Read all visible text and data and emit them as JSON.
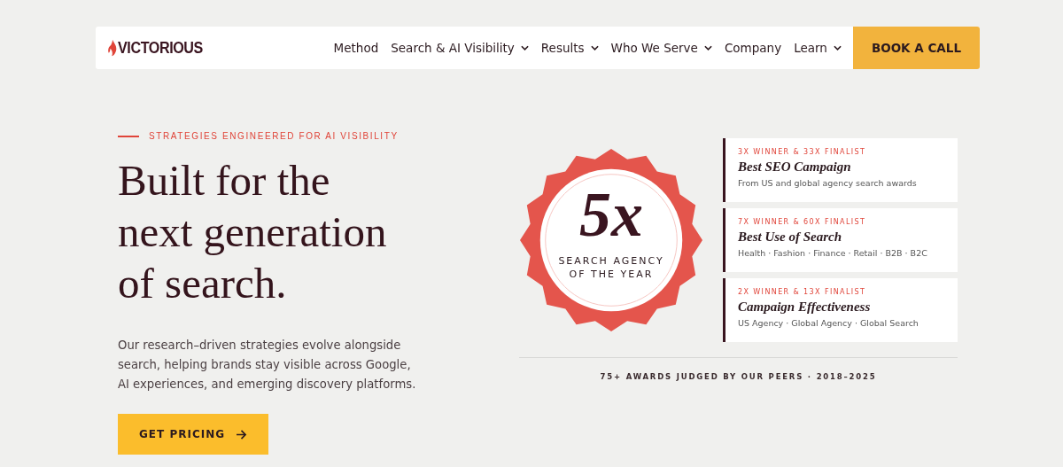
{
  "header": {
    "logo": "VICTORIOUS",
    "nav": [
      {
        "label": "Method",
        "has_menu": false
      },
      {
        "label": "Search & AI Visibility",
        "has_menu": true
      },
      {
        "label": "Results",
        "has_menu": true
      },
      {
        "label": "Who We Serve",
        "has_menu": true
      },
      {
        "label": "Company",
        "has_menu": false
      },
      {
        "label": "Learn",
        "has_menu": true
      }
    ],
    "cta": "BOOK A CALL"
  },
  "hero": {
    "eyebrow": "STRATEGIES ENGINEERED FOR AI VISIBILITY",
    "heading": [
      "Built for the",
      "next generation",
      "of search."
    ],
    "description": "Our research–driven strategies evolve alongside search, helping brands stay visible across Google, AI experiences, and emerging discovery platforms.",
    "button": "GET PRICING"
  },
  "badge": {
    "count": "5x",
    "caption": [
      "SEARCH AGENCY",
      "OF THE YEAR"
    ]
  },
  "awards": [
    {
      "tally": "3X WINNER & 33X FINALIST",
      "title": "Best SEO Campaign",
      "detail": "From US and global agency search awards"
    },
    {
      "tally": "7X WINNER & 60X FINALIST",
      "title": "Best Use of Search",
      "detail": "Health · Fashion · Finance · Retail · B2B · B2C"
    },
    {
      "tally": "2X WINNER & 13X FINALIST",
      "title": "Campaign Effectiveness",
      "detail": "US Agency · Global Agency · Global Search"
    }
  ],
  "footnote": "75+ AWARDS JUDGED BY OUR PEERS · 2018–2025"
}
